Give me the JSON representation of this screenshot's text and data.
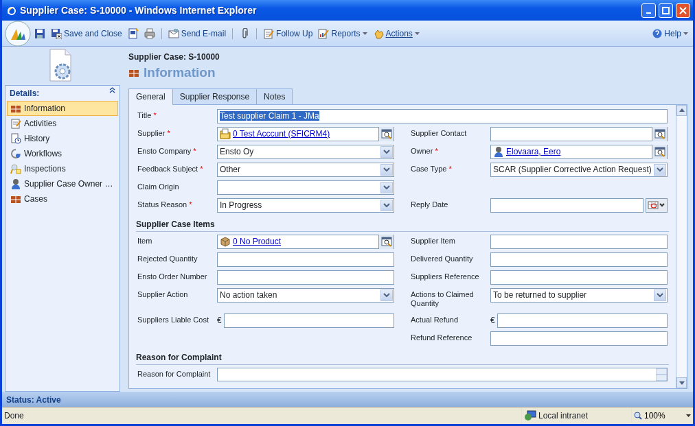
{
  "window": {
    "title": "Supplier Case: S-10000 - Windows Internet Explorer"
  },
  "toolbar": {
    "items": [
      {
        "kind": "icon"
      },
      {
        "kind": "button",
        "label": "Save and Close"
      },
      {
        "kind": "icon"
      },
      {
        "kind": "icon"
      },
      {
        "kind": "separator"
      },
      {
        "kind": "button",
        "label": "Send E-mail"
      },
      {
        "kind": "separator"
      },
      {
        "kind": "icon"
      },
      {
        "kind": "separator"
      },
      {
        "kind": "button",
        "label": "Follow Up"
      },
      {
        "kind": "menu",
        "label": "Reports"
      },
      {
        "kind": "menu",
        "label": "Actions"
      }
    ],
    "help": {
      "label": "Help"
    }
  },
  "record": {
    "subtitle": "Supplier Case: S-10000",
    "heading": "Information"
  },
  "sidebar": {
    "title": "Details:",
    "items": [
      {
        "label": "Information",
        "selected": true
      },
      {
        "label": "Activities",
        "selected": false
      },
      {
        "label": "History",
        "selected": false
      },
      {
        "label": "Workflows",
        "selected": false
      },
      {
        "label": "Inspections",
        "selected": false
      },
      {
        "label": "Supplier Case Owner …",
        "selected": false
      },
      {
        "label": "Cases",
        "selected": false
      }
    ]
  },
  "tabs": [
    {
      "label": "General",
      "selected": true
    },
    {
      "label": "Supplier Response",
      "selected": false
    },
    {
      "label": "Notes",
      "selected": false
    }
  ],
  "sections": [
    {
      "rows": [
        {
          "wide": {
            "label": "Title",
            "required_mark": "*",
            "kind": "text",
            "value": "Test supplier Claim 1 - JMa",
            "text_selected": true
          }
        },
        {
          "left": {
            "label": "Supplier",
            "required_mark": "*",
            "kind": "lookup",
            "value": "0 Test Acccunt (SFICRM4)"
          },
          "right": {
            "label": "Supplier Contact",
            "kind": "lookup"
          }
        },
        {
          "left": {
            "label": "Ensto Company",
            "required_mark": "*",
            "kind": "select",
            "value": "Ensto Oy"
          },
          "right": {
            "label": "Owner",
            "required_mark": "*",
            "kind": "lookup",
            "value": "Elovaara, Eero"
          }
        },
        {
          "left": {
            "label": "Feedback Subject",
            "required_mark": "*",
            "kind": "select",
            "value": "Other"
          },
          "right": {
            "label": "Case Type",
            "required_mark": "*",
            "kind": "select",
            "value": "SCAR (Supplier Corrective Action Request)"
          }
        },
        {
          "left": {
            "label": "Claim Origin",
            "kind": "select"
          }
        },
        {
          "left": {
            "label": "Status Reason",
            "required_mark": "*",
            "kind": "select",
            "value": "In Progress"
          },
          "right": {
            "label": "Reply Date",
            "kind": "date"
          }
        }
      ]
    },
    {
      "heading": "Supplier Case Items",
      "rows": [
        {
          "left": {
            "label": "Item",
            "kind": "lookup",
            "value": "0 No Product"
          },
          "right": {
            "label": "Supplier Item",
            "kind": "text"
          }
        },
        {
          "left": {
            "label": "Rejected Quantity",
            "kind": "text"
          },
          "right": {
            "label": "Delivered Quantity",
            "kind": "text"
          }
        },
        {
          "left": {
            "label": "Ensto Order Number",
            "kind": "text"
          },
          "right": {
            "label": "Suppliers Reference",
            "kind": "text"
          }
        },
        {
          "left": {
            "label": "Supplier Action",
            "kind": "select",
            "value": "No action taken"
          },
          "right": {
            "label": "Actions to Claimed Quantity",
            "kind": "select",
            "value": "To be returned to supplier"
          }
        },
        {
          "left": {
            "label": "Suppliers Liable Cost",
            "kind": "money",
            "currency": "€"
          },
          "right": {
            "label": "Actual Refund",
            "kind": "money",
            "currency": "€"
          }
        },
        {
          "right": {
            "label": "Refund Reference",
            "kind": "text"
          }
        }
      ]
    },
    {
      "heading": "Reason for Complaint",
      "rows": [
        {
          "wide": {
            "label": "Reason for Complaint",
            "kind": "textarea"
          }
        }
      ]
    }
  ],
  "status": "Status: Active",
  "browser_status": {
    "text": "Done",
    "zone": "Local intranet",
    "zoom": "100%"
  }
}
